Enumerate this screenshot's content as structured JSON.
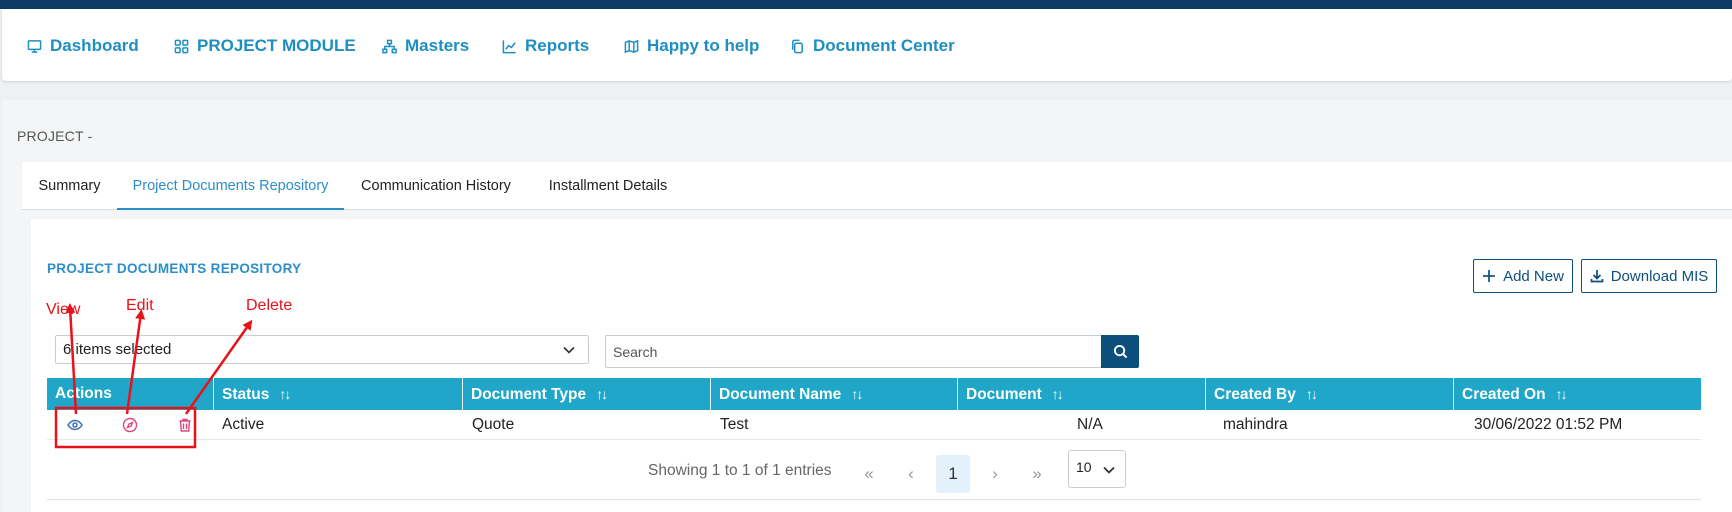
{
  "nav": {
    "items": [
      {
        "label": "Dashboard",
        "icon": "monitor-icon"
      },
      {
        "label": "PROJECT MODULE",
        "icon": "grid-icon"
      },
      {
        "label": "Masters",
        "icon": "sitemap-icon"
      },
      {
        "label": "Reports",
        "icon": "chart-line-icon"
      },
      {
        "label": "Happy to help",
        "icon": "map-icon"
      },
      {
        "label": "Document Center",
        "icon": "copy-icon"
      }
    ]
  },
  "page": {
    "project_label": "PROJECT -"
  },
  "tabs": [
    {
      "label": "Summary",
      "active": false
    },
    {
      "label": "Project Documents Repository",
      "active": true
    },
    {
      "label": "Communication History",
      "active": false
    },
    {
      "label": "Installment Details",
      "active": false
    }
  ],
  "panel": {
    "title": "PROJECT DOCUMENTS REPOSITORY",
    "add_new_label": "Add New",
    "download_label": "Download MIS"
  },
  "filters": {
    "columns_select_value": "6 items selected",
    "search_placeholder": "Search"
  },
  "table": {
    "headers": [
      "Actions",
      "Status",
      "Document Type",
      "Document Name",
      "Document",
      "Created By",
      "Created On"
    ],
    "rows": [
      {
        "status": "Active",
        "document_type": "Quote",
        "document_name": "Test",
        "document": "N/A",
        "created_by": "mahindra",
        "created_on": "30/06/2022 01:52 PM"
      }
    ]
  },
  "pagination": {
    "info": "Showing 1 to 1 of 1 entries",
    "first": "«",
    "prev": "‹",
    "current_page": "1",
    "next": "›",
    "last": "»",
    "page_size": "10"
  },
  "annotations": {
    "view": "View",
    "edit": "Edit",
    "delete": "Delete"
  },
  "colors": {
    "accent": "#1e8fc0",
    "header_bg": "#1fa6c8",
    "primary_dark": "#0d4f7c",
    "annotation_red": "#e8121a"
  }
}
